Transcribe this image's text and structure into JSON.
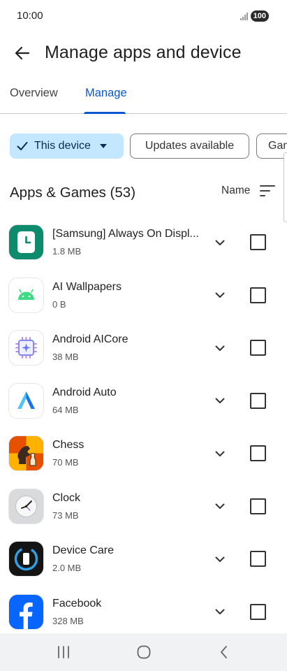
{
  "status_bar": {
    "time": "10:00",
    "battery": "100"
  },
  "header": {
    "title": "Manage apps and device"
  },
  "tabs": [
    {
      "label": "Overview",
      "selected": false
    },
    {
      "label": "Manage",
      "selected": true
    }
  ],
  "filters": {
    "device": "This device",
    "updates": "Updates available",
    "games": "Gam"
  },
  "section": {
    "title": "Apps & Games (53)",
    "sort_label": "Name"
  },
  "apps": [
    {
      "name": "[Samsung] Always On Displ...",
      "size": "1.8 MB",
      "icon": "aod-clock-icon"
    },
    {
      "name": "AI Wallpapers",
      "size": "0 B",
      "icon": "android-robot-icon"
    },
    {
      "name": "Android AICore",
      "size": "38 MB",
      "icon": "chip-icon"
    },
    {
      "name": "Android Auto",
      "size": "64 MB",
      "icon": "android-auto-icon"
    },
    {
      "name": "Chess",
      "size": "70 MB",
      "icon": "chess-icon"
    },
    {
      "name": "Clock",
      "size": "73 MB",
      "icon": "clock-icon"
    },
    {
      "name": "Device Care",
      "size": "2.0 MB",
      "icon": "device-care-icon"
    },
    {
      "name": "Facebook",
      "size": "328 MB",
      "icon": "facebook-icon"
    }
  ],
  "colors": {
    "accent": "#0b57d0",
    "chip_selected_bg": "#c2e7ff"
  }
}
